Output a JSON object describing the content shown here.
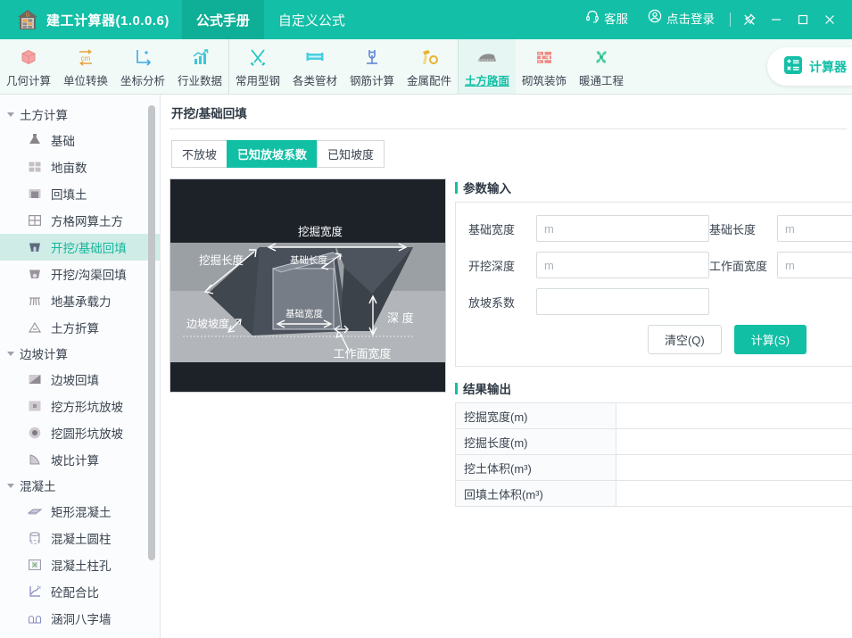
{
  "app": {
    "title": "建工计算器(1.0.0.6)",
    "logo_icon": "house-calculator-icon",
    "tabs": [
      {
        "label": "公式手册",
        "active": true
      },
      {
        "label": "自定义公式",
        "active": false
      }
    ],
    "support_label": "客服",
    "support_icon": "headset-icon",
    "login_label": "点击登录",
    "login_icon": "user-circle-icon",
    "pin_icon": "pin-icon",
    "minimize_icon": "minimize-icon",
    "maximize_icon": "maximize-icon",
    "close_icon": "close-icon"
  },
  "colors": {
    "brand_teal": "#13BFA6",
    "brand_teal_dark": "#0FAE96",
    "accent": "#11BFA4",
    "selected_bg": "#CFEDE6",
    "diagram_bg": "#1D2229"
  },
  "toolbar": {
    "groups": [
      {
        "items": [
          {
            "label": "几何计算",
            "icon": "cube-icon",
            "active": false
          },
          {
            "label": "单位转换",
            "icon": "cm-convert-icon",
            "active": false
          },
          {
            "label": "坐标分析",
            "icon": "axes-icon",
            "active": false
          },
          {
            "label": "行业数据",
            "icon": "bar-chart-icon",
            "active": false
          }
        ]
      },
      {
        "items": [
          {
            "label": "常用型钢",
            "icon": "tools-icon",
            "active": false
          },
          {
            "label": "各类管材",
            "icon": "pipe-icon",
            "active": false
          },
          {
            "label": "钢筋计算",
            "icon": "rebar-icon",
            "active": false
          },
          {
            "label": "金属配件",
            "icon": "hammer-bolt-icon",
            "active": false
          }
        ]
      },
      {
        "items": [
          {
            "label": "土方路面",
            "icon": "road-icon",
            "active": true
          },
          {
            "label": "砌筑装饰",
            "icon": "brick-wall-icon",
            "active": false
          },
          {
            "label": "暖通工程",
            "icon": "fan-icon",
            "active": false
          }
        ]
      }
    ],
    "calculator_button": {
      "label": "计算器",
      "icon": "calculator-icon"
    }
  },
  "sidebar": {
    "groups": [
      {
        "label": "土方计算",
        "items": [
          {
            "label": "基础",
            "icon": "foundation-icon",
            "selected": false
          },
          {
            "label": "地亩数",
            "icon": "grid-field-icon",
            "selected": false
          },
          {
            "label": "回填土",
            "icon": "backfill-icon",
            "selected": false
          },
          {
            "label": "方格网算土方",
            "icon": "grid-net-icon",
            "selected": false
          },
          {
            "label": "开挖/基础回填",
            "icon": "excavation-icon",
            "selected": true
          },
          {
            "label": "开挖/沟渠回填",
            "icon": "trench-icon",
            "selected": false
          },
          {
            "label": "地基承载力",
            "icon": "bearing-capacity-icon",
            "selected": false
          },
          {
            "label": "土方折算",
            "icon": "soil-convert-icon",
            "selected": false
          }
        ]
      },
      {
        "label": "边坡计算",
        "items": [
          {
            "label": "边坡回填",
            "icon": "slope-backfill-icon",
            "selected": false
          },
          {
            "label": "挖方形坑放坡",
            "icon": "square-pit-icon",
            "selected": false
          },
          {
            "label": "挖圆形坑放坡",
            "icon": "round-pit-icon",
            "selected": false
          },
          {
            "label": "坡比计算",
            "icon": "slope-ratio-icon",
            "selected": false
          }
        ]
      },
      {
        "label": "混凝土",
        "items": [
          {
            "label": "矩形混凝土",
            "icon": "rect-concrete-icon",
            "selected": false
          },
          {
            "label": "混凝土圆柱",
            "icon": "cylinder-icon",
            "selected": false
          },
          {
            "label": "混凝土柱孔",
            "icon": "column-hole-icon",
            "selected": false
          },
          {
            "label": "砼配合比",
            "icon": "mix-ratio-icon",
            "selected": false
          },
          {
            "label": "涵洞八字墙",
            "icon": "culvert-wall-icon",
            "selected": false
          }
        ]
      }
    ]
  },
  "main": {
    "page_title": "开挖/基础回填",
    "segments": [
      {
        "label": "不放坡",
        "active": false
      },
      {
        "label": "已知放坡系数",
        "active": true
      },
      {
        "label": "已知坡度",
        "active": false
      }
    ],
    "diagram": {
      "name": "excavation-diagram",
      "labels": {
        "dig_width": "挖掘宽度",
        "dig_length": "挖掘长度",
        "base_length": "基础长度",
        "base_width": "基础宽度",
        "slope_grade": "边坡坡度",
        "depth": "深 度",
        "work_face_width": "工作面宽度"
      }
    },
    "param_section": {
      "title": "参数输入",
      "fields": [
        {
          "label": "基础宽度",
          "placeholder": "m",
          "value": "",
          "name": "base-width-input"
        },
        {
          "label": "基础长度",
          "placeholder": "m",
          "value": "",
          "name": "base-length-input"
        },
        {
          "label": "开挖深度",
          "placeholder": "m",
          "value": "",
          "name": "excavation-depth-input"
        },
        {
          "label": "工作面宽度",
          "placeholder": "m",
          "value": "",
          "name": "work-face-width-input"
        },
        {
          "label": "放坡系数",
          "placeholder": "",
          "value": "",
          "name": "slope-coefficient-input"
        }
      ],
      "clear_button": "清空(Q)",
      "calc_button": "计算(S)"
    },
    "result_section": {
      "title": "结果输出",
      "rows": [
        {
          "key": "挖掘宽度(m)",
          "value": ""
        },
        {
          "key": "挖掘长度(m)",
          "value": ""
        },
        {
          "key": "挖土体积(m³)",
          "value": ""
        },
        {
          "key": "回填土体积(m³)",
          "value": ""
        }
      ]
    }
  }
}
